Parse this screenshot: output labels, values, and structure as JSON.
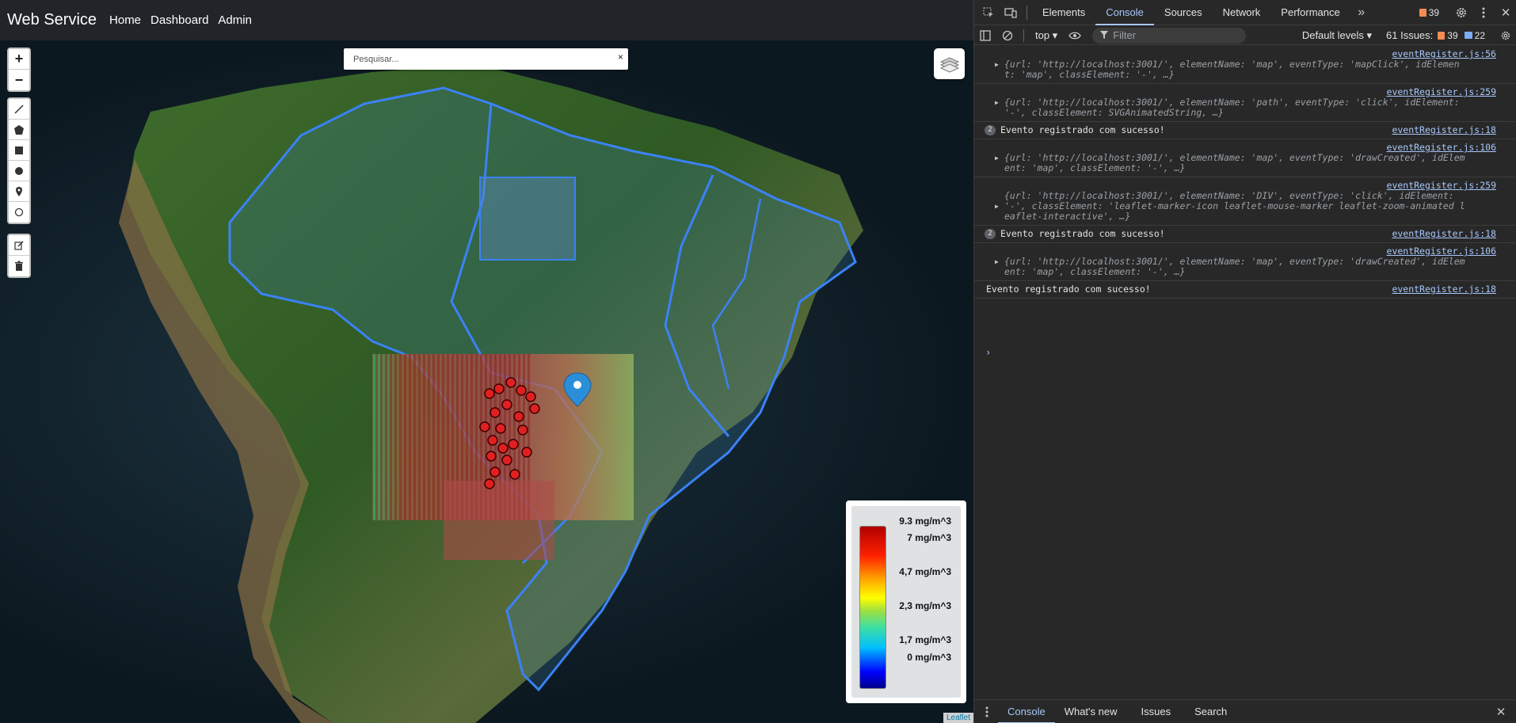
{
  "navbar": {
    "brand": "Web Service",
    "links": [
      "Home",
      "Dashboard",
      "Admin"
    ]
  },
  "map": {
    "search_placeholder": "Pesquisar...",
    "search_clear": "×",
    "zoom_in": "+",
    "zoom_out": "−",
    "attribution": "Leaflet",
    "legend": {
      "labels": [
        "9.3 mg/m^3",
        "7 mg/m^3",
        "4,7 mg/m^3",
        "2,3 mg/m^3",
        "1,7 mg/m^3",
        "0 mg/m^3"
      ]
    },
    "draw_tools": [
      "polyline-icon",
      "polygon-icon",
      "rectangle-icon",
      "circle-icon",
      "marker-icon",
      "circlemarker-icon"
    ],
    "edit_tools": [
      "edit-icon",
      "trash-icon"
    ]
  },
  "devtools": {
    "tabs": [
      "Elements",
      "Console",
      "Sources",
      "Network",
      "Performance"
    ],
    "active_tab": "Console",
    "more": "»",
    "warn_count": "39",
    "toolbar": {
      "context": "top ▾",
      "filter_placeholder": "Filter",
      "levels": "Default levels ▾",
      "issues_label": "61 Issues:",
      "issues_warn": "39",
      "issues_info": "22"
    },
    "logs": [
      {
        "source": "eventRegister.js:56",
        "line1": "{url: 'http://localhost:3001/', elementName: 'map', eventType: 'mapClick', idElemen",
        "line2": "t: 'map', classElement: '-', …}"
      },
      {
        "source": "eventRegister.js:259",
        "line1": "{url: 'http://localhost:3001/', elementName: 'path', eventType: 'click', idElement:",
        "line2": "'-', classElement: SVGAnimatedString, …}"
      },
      {
        "source": "eventRegister.js:18",
        "count": "2",
        "message": "Evento registrado com sucesso!"
      },
      {
        "source": "eventRegister.js:106",
        "line1": "{url: 'http://localhost:3001/', elementName: 'map', eventType: 'drawCreated', idElem",
        "line2": "ent: 'map', classElement: '-', …}"
      },
      {
        "source": "eventRegister.js:259",
        "line1": "{url: 'http://localhost:3001/', elementName: 'DIV', eventType: 'click', idElement:",
        "line2": "'-', classElement: 'leaflet-marker-icon leaflet-mouse-marker leaflet-zoom-animated l",
        "line3": "eaflet-interactive', …}"
      },
      {
        "source": "eventRegister.js:18",
        "count": "2",
        "message": "Evento registrado com sucesso!"
      },
      {
        "source": "eventRegister.js:106",
        "line1": "{url: 'http://localhost:3001/', elementName: 'map', eventType: 'drawCreated', idElem",
        "line2": "ent: 'map', classElement: '-', …}"
      },
      {
        "source": "eventRegister.js:18",
        "message": "Evento registrado com sucesso!"
      }
    ],
    "prompt": "›",
    "drawer_tabs": [
      "Console",
      "What's new",
      "Issues",
      "Search"
    ],
    "drawer_active": "Console",
    "close": "✕"
  }
}
